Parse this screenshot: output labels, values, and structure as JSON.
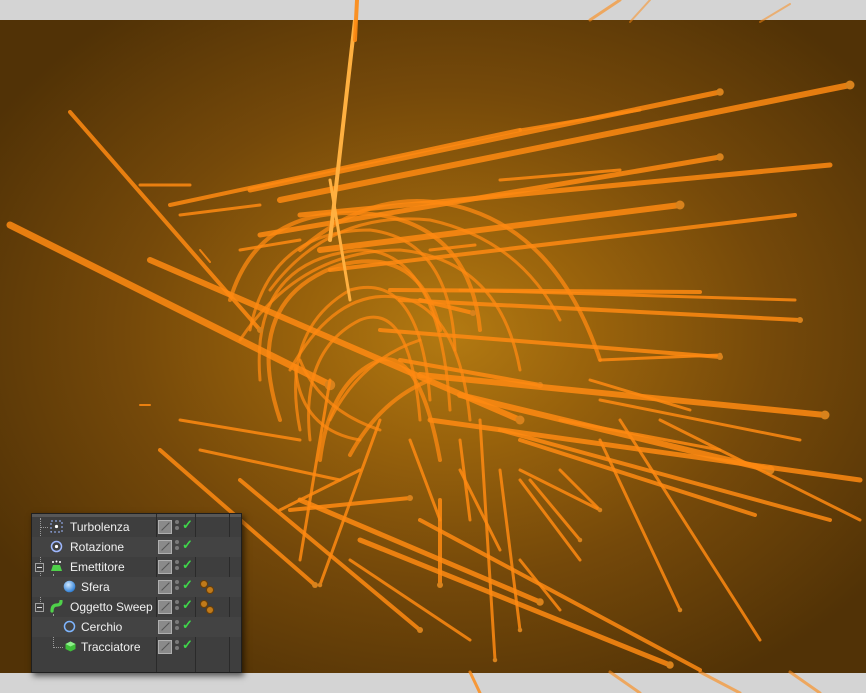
{
  "colors": {
    "strand": "#ff8a12",
    "strand_highlight": "#ffb040",
    "panel_bg": "#3e3e3e",
    "check": "#3fd64a",
    "outer_bg": "#d4d4d4"
  },
  "object_manager": {
    "rows": [
      {
        "label": "Turbolenza",
        "icon": "turbulence-icon",
        "tags": false
      },
      {
        "label": "Rotazione",
        "icon": "rotation-icon",
        "tags": false
      },
      {
        "label": "Emettitore",
        "icon": "emitter-icon",
        "tags": false
      },
      {
        "label": "Sfera",
        "icon": "sphere-icon",
        "tags": true
      },
      {
        "label": "Oggetto Sweep",
        "icon": "sweep-icon",
        "tags": true
      },
      {
        "label": "Cerchio",
        "icon": "circle-icon",
        "tags": false
      },
      {
        "label": "Tracciatore",
        "icon": "tracer-icon",
        "tags": false
      }
    ]
  }
}
